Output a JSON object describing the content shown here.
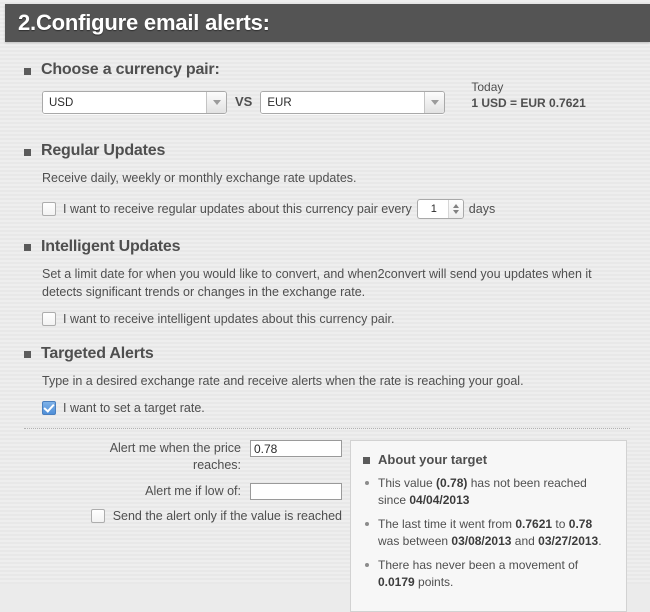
{
  "header": {
    "title": "2.Configure email alerts:"
  },
  "currency_pair": {
    "heading": "Choose a currency pair:",
    "from": {
      "value": "USD",
      "dropdown_icon": "chevron-down-icon"
    },
    "vs_label": "VS",
    "to": {
      "value": "EUR",
      "dropdown_icon": "chevron-down-icon"
    },
    "today_label": "Today",
    "today_rate": "1 USD = EUR 0.7621"
  },
  "regular_updates": {
    "heading": "Regular Updates",
    "description": "Receive daily, weekly or monthly exchange rate updates.",
    "checkbox_checked": false,
    "label_before": "I want to receive regular updates about this currency pair every",
    "interval_value": "1",
    "label_after": "days"
  },
  "intelligent_updates": {
    "heading": "Intelligent Updates",
    "description": "Set a limit date for when you would like to convert, and when2convert will send you updates when it detects significant trends or changes in the exchange rate.",
    "checkbox_checked": false,
    "checkbox_label": "I want to receive intelligent updates about this currency pair."
  },
  "targeted_alerts": {
    "heading": "Targeted Alerts",
    "description": "Type in a desired exchange rate and receive alerts when the rate is reaching your goal.",
    "checkbox_checked": true,
    "checkbox_label": "I want to set a target rate."
  },
  "target_form": {
    "price_label": "Alert me when the price reaches:",
    "price_value": "0.78",
    "price_placeholder": "",
    "low_label": "Alert me if low of:",
    "low_value": "",
    "low_placeholder": "",
    "only_if_reached_checked": false,
    "only_if_reached_label": "Send the alert only if the value is reached"
  },
  "about_target": {
    "title": "About your target",
    "bullets": [
      {
        "parts": [
          {
            "text": "This value ",
            "bold": false
          },
          {
            "text": "(0.78)",
            "bold": true
          },
          {
            "text": " has not been reached since ",
            "bold": false
          },
          {
            "text": "04/04/2013",
            "bold": true
          }
        ]
      },
      {
        "parts": [
          {
            "text": "The last time it went from ",
            "bold": false
          },
          {
            "text": "0.7621",
            "bold": true
          },
          {
            "text": " to ",
            "bold": false
          },
          {
            "text": "0.78",
            "bold": true
          },
          {
            "text": " was between ",
            "bold": false
          },
          {
            "text": "03/08/2013",
            "bold": true
          },
          {
            "text": " and ",
            "bold": false
          },
          {
            "text": "03/27/2013",
            "bold": true
          },
          {
            "text": ".",
            "bold": false
          }
        ]
      },
      {
        "parts": [
          {
            "text": "There has never been a movement of ",
            "bold": false
          },
          {
            "text": "0.0179",
            "bold": true
          },
          {
            "text": " points.",
            "bold": false
          }
        ]
      }
    ]
  },
  "colors": {
    "header_bg": "#545454",
    "page_bg": "#ebebeb",
    "text": "#4f4f4f",
    "checkbox_checked": "#4f8fd8",
    "panel_bg": "#f7f7f7"
  }
}
